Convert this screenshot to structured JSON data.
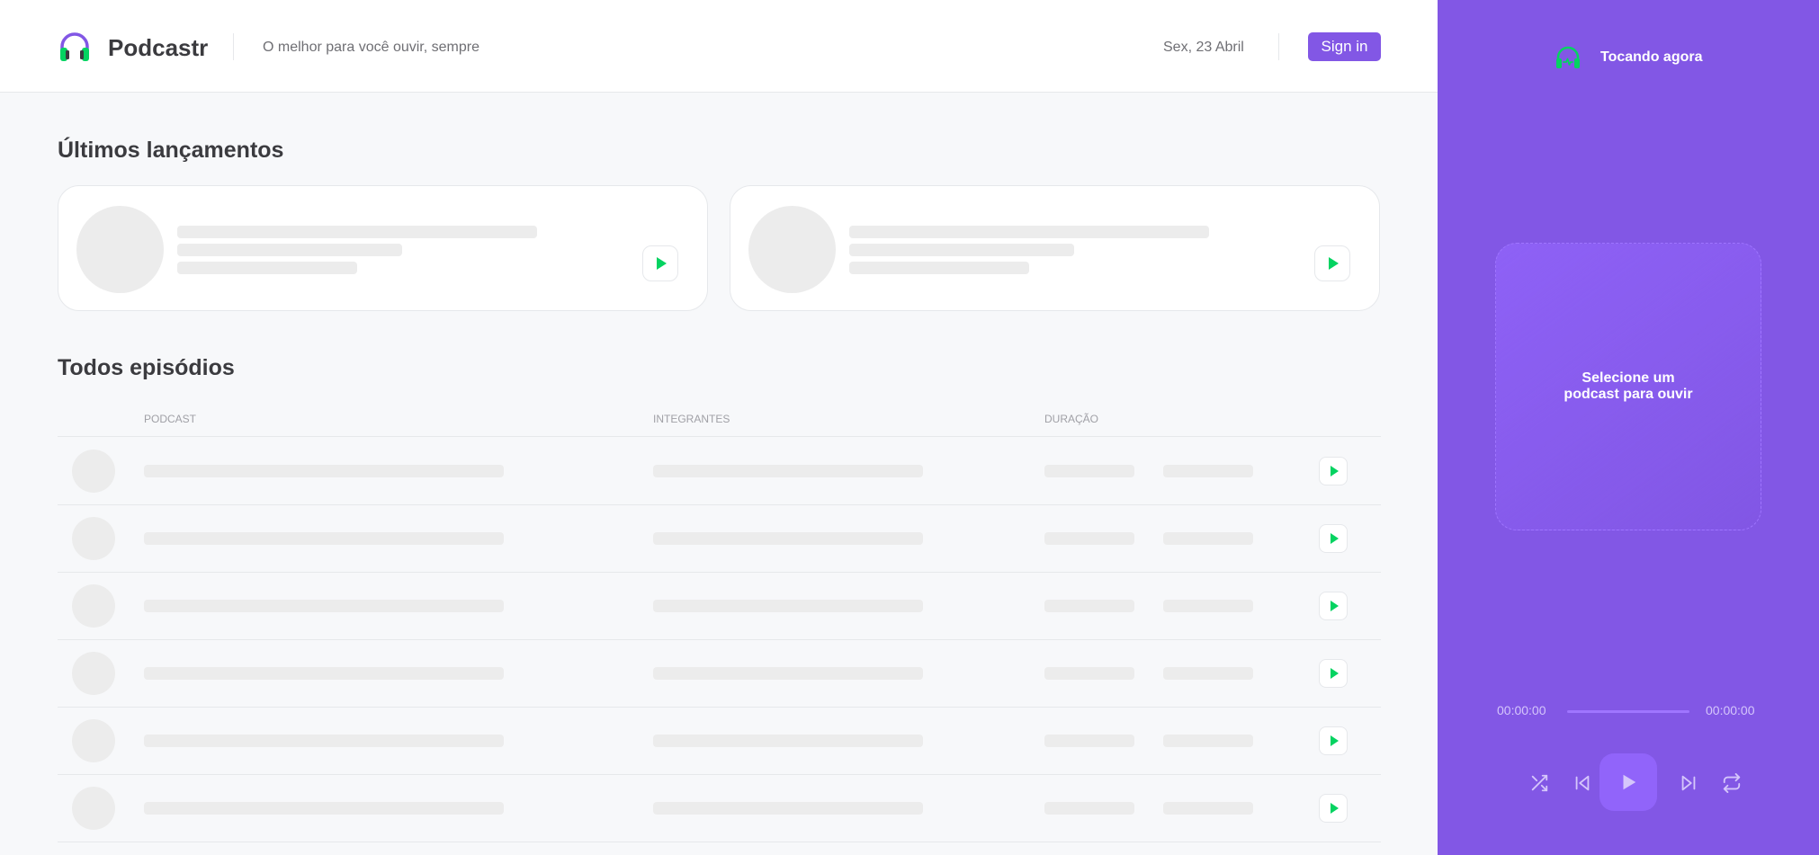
{
  "header": {
    "brand": "Podcastr",
    "tagline": "O melhor para você ouvir, sempre",
    "date": "Sex, 23 Abril",
    "signin_label": "Sign in"
  },
  "latest": {
    "title": "Últimos lançamentos"
  },
  "episodes": {
    "title": "Todos episódios",
    "columns": [
      "PODCAST",
      "INTEGRANTES",
      "DURAÇÃO"
    ]
  },
  "player": {
    "title": "Tocando agora",
    "empty_line1": "Selecione um",
    "empty_line2": "podcast para ouvir",
    "time_current": "00:00:00",
    "time_total": "00:00:00",
    "progress": 0
  },
  "colors": {
    "accent": "#8257e5",
    "play": "#04d361",
    "skeleton": "#ececec"
  },
  "icons": [
    "headphones-logo-icon",
    "playing-headphones-icon",
    "play-icon",
    "shuffle-icon",
    "previous-icon",
    "next-icon",
    "repeat-icon"
  ]
}
